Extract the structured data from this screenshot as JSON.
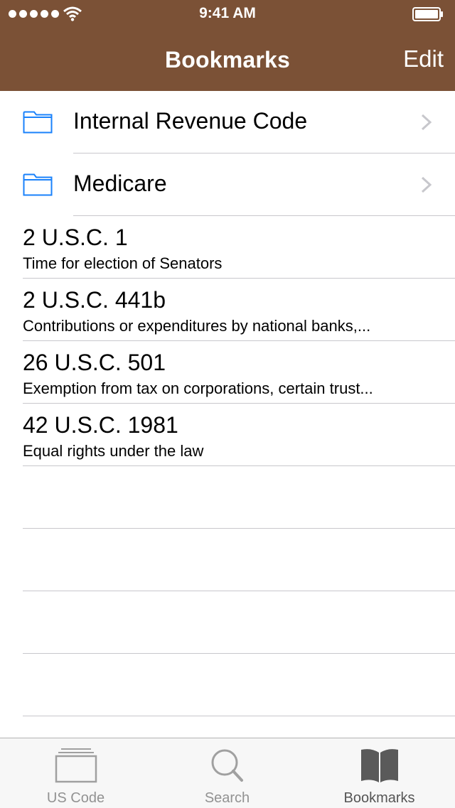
{
  "status": {
    "time": "9:41 AM"
  },
  "nav": {
    "title": "Bookmarks",
    "edit_label": "Edit"
  },
  "folders": [
    {
      "label": "Internal Revenue Code"
    },
    {
      "label": "Medicare"
    }
  ],
  "bookmarks": [
    {
      "title": "2 U.S.C. 1",
      "subtitle": "Time for election of Senators"
    },
    {
      "title": "2 U.S.C. 441b",
      "subtitle": "Contributions or expenditures by national banks,..."
    },
    {
      "title": "26 U.S.C. 501",
      "subtitle": "Exemption from tax on corporations, certain trust..."
    },
    {
      "title": "42 U.S.C. 1981",
      "subtitle": "Equal rights under the law"
    }
  ],
  "tabs": [
    {
      "label": "US Code",
      "icon": "us-code-icon"
    },
    {
      "label": "Search",
      "icon": "search-icon"
    },
    {
      "label": "Bookmarks",
      "icon": "bookmarks-icon"
    }
  ],
  "colors": {
    "nav_brown": "#7b5136",
    "folder_blue": "#1a82fb"
  }
}
